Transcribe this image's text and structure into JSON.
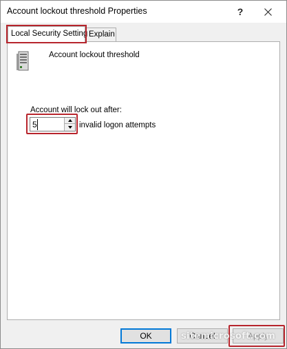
{
  "window": {
    "title": "Account lockout threshold Properties",
    "help_label": "?"
  },
  "tabs": [
    {
      "label": "Local Security Setting",
      "active": true
    },
    {
      "label": "Explain",
      "active": false
    }
  ],
  "policy": {
    "name": "Account lockout threshold",
    "icon": "server-icon"
  },
  "lockout": {
    "label": "Account will lock out after:",
    "value": "5",
    "suffix": "invalid logon attempts"
  },
  "buttons": {
    "ok": "OK",
    "cancel": "Cancel",
    "apply": "Apply"
  },
  "watermark": "sitemicrosoft.com",
  "colors": {
    "highlight": "#b7242c",
    "ok_border": "#0078d7"
  }
}
